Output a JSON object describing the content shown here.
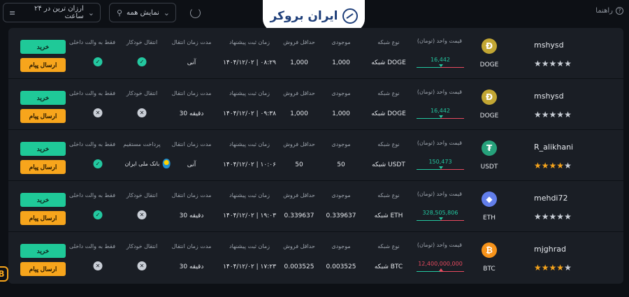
{
  "header": {
    "sort_label": "ارزان ترین در ۲۴ ساعت",
    "show_label": "نمایش همه",
    "logo_text": "ایران بروکر",
    "guide_label": "راهنما"
  },
  "columns": {
    "unit_price": "قیمت واحد (تومان)",
    "network": "نوع شبکه",
    "stock": "موجودی",
    "min_sale": "حداقل فروش",
    "offer_time": "زمان ثبت پیشنهاد",
    "transfer_time": "مدت زمان انتقال",
    "auto_transfer": "انتقال خودکار",
    "direct_payment": "پرداخت مستقیم",
    "internal_wallet": "فقط به والت داخلی"
  },
  "buttons": {
    "buy": "خرید",
    "message": "ارسال پیام"
  },
  "colors": {
    "buy": "#1fc998",
    "message": "#f7a51c",
    "price_up": "#23c8a0",
    "price_down": "#e84a5f",
    "star": "#f7a51c",
    "star_empty": "#c9ced6"
  },
  "offers": [
    {
      "username": "mshysd",
      "rating": 0,
      "coin_symbol": "DOGE",
      "coin_icon": "dogecoin-icon",
      "coin_glyph": "Ð",
      "coin_color": "#c2a633",
      "price": "16,442",
      "price_trend": "down",
      "network": "شبکه DOGE",
      "stock": "1,000",
      "min_sale": "1,000",
      "offer_time": "۱۴۰۴/۱۲/۰۲ | ۰۸:۲۹",
      "transfer_time": "آنی",
      "col7_kind": "auto_transfer",
      "col7_state": "check",
      "internal_wallet": "check"
    },
    {
      "username": "mshysd",
      "rating": 0,
      "coin_symbol": "DOGE",
      "coin_icon": "dogecoin-icon",
      "coin_glyph": "Ð",
      "coin_color": "#c2a633",
      "price": "16,442",
      "price_trend": "down",
      "network": "شبکه DOGE",
      "stock": "1,000",
      "min_sale": "1,000",
      "offer_time": "۱۴۰۴/۱۲/۰۲ | ۰۹:۳۸",
      "transfer_time": "30 دقیقه",
      "col7_kind": "auto_transfer",
      "col7_state": "cross",
      "internal_wallet": "cross"
    },
    {
      "username": "R_alikhani",
      "rating": 4,
      "coin_symbol": "USDT",
      "coin_icon": "tether-icon",
      "coin_glyph": "₮",
      "coin_color": "#26a17b",
      "price": "150,473",
      "price_trend": "down",
      "network": "شبکه USDT",
      "stock": "50",
      "min_sale": "50",
      "offer_time": "۱۴۰۴/۱۲/۰۲ | ۱۰:۰۶",
      "transfer_time": "آنی",
      "col7_kind": "direct_payment",
      "col7_state": "bank",
      "bank_name": "بانک ملی ایران",
      "internal_wallet": "check"
    },
    {
      "username": "mehdi72",
      "rating": 0,
      "coin_symbol": "ETH",
      "coin_icon": "ethereum-icon",
      "coin_glyph": "◆",
      "coin_color": "#627eea",
      "price": "328,505,806",
      "price_trend": "down",
      "network": "شبکه ETH",
      "stock": "0.339637",
      "min_sale": "0.339637",
      "offer_time": "۱۴۰۴/۱۲/۰۲ | ۱۹:۰۳",
      "transfer_time": "30 دقیقه",
      "col7_kind": "auto_transfer",
      "col7_state": "cross",
      "internal_wallet": "check"
    },
    {
      "username": "mjghrad",
      "rating": 4,
      "coin_symbol": "BTC",
      "coin_icon": "bitcoin-icon",
      "coin_glyph": "₿",
      "coin_color": "#f7931a",
      "price": "12,400,000,000",
      "price_trend": "up",
      "network": "شبکه BTC",
      "stock": "0.003525",
      "min_sale": "0.003525",
      "offer_time": "۱۴۰۴/۱۲/۰۲ | ۱۷:۲۳",
      "transfer_time": "30 دقیقه",
      "col7_kind": "auto_transfer",
      "col7_state": "cross",
      "internal_wallet": "cross"
    }
  ]
}
